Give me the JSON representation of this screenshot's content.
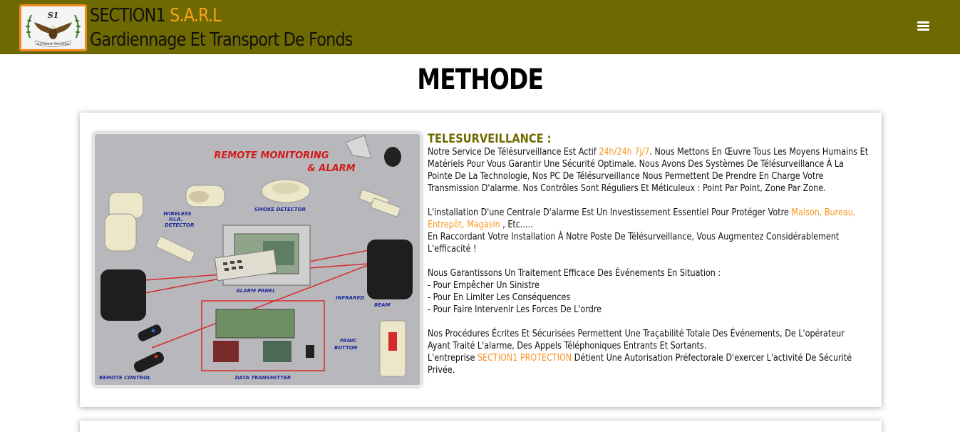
{
  "header": {
    "brand_name": "SECTION1",
    "brand_suffix": "S.A.R.L",
    "tagline": "Gardiennage Et Transport De Fonds",
    "logo_text": "S1",
    "logo_ribbon": "Section1 Sécurité",
    "menu_icon": "hamburger-icon"
  },
  "page": {
    "title": "METHODE"
  },
  "section": {
    "heading": "TELESURVEILLANCE :",
    "image": {
      "title_line1": "REMOTE MONITORING",
      "title_line2": "& ALARM",
      "labels": {
        "wireless": "WIRELESS",
        "pir": "P.I.R.",
        "detector": "DETECTOR",
        "smoke": "SMOKE DETECTOR",
        "alarm_panel": "ALARM PANEL",
        "infrared": "INFRARED",
        "beam": "BEAM",
        "panic": "PANIC",
        "button": "BUTTON",
        "remote_control": "REMOTE CONTROL",
        "data_transmitter": "DATA TRANSMITTER"
      }
    },
    "p1": {
      "a": "Notre Service De Télésurveillance Est Actif ",
      "hl": "24h/24h 7j/7",
      "b": ". Nous Mettons En Œuvre Tous Les Moyens Humains Et Matériels Pour Vous Garantir Une Sécurité Optimale. Nous Avons Des Systèmes De Télésurveillance À La Pointe De La Technologie, Nos PC De Télésurveillance Nous Permettent De Prendre En Charge Votre Transmission D'alarme. Nos Contrôles Sont Réguliers Et Méticuleux : Point Par Point, Zone Par Zone."
    },
    "p2": {
      "a": "L'installation D'une Centrale D'alarme Est Un Investissement Essentiel Pour Protéger Votre ",
      "hl": "Maison, Bureau, Entrepôt, Magasin",
      "b": " , Etc.....",
      "c": "En Raccordant Votre Installation À Notre Poste De Télésurveillance, Vous Augmentez Considérablement L'efficacité !"
    },
    "p3": {
      "intro": "Nous Garantissons Un Traitement Efficace Des Événements En Situation :",
      "items": [
        "- Pour Empêcher Un Sinistre",
        "- Pour En Limiter Les Conséquences",
        "- Pour Faire Intervenir Les Forces De L'ordre"
      ]
    },
    "p4": {
      "a": "Nos Procédures Écrites Et Sécurisées Permettent Une Traçabilité Totale Des Événements, De L'opérateur Ayant Traité L'alarme, Des Appels Téléphoniques Entrants Et Sortants.",
      "b": "L'entreprise ",
      "hl": "SECTION1 PROTECTION",
      "c": " Détient Une Autorisation Préfectorale D'exercer L'activité De Sécurité Privée."
    }
  },
  "colors": {
    "navbar": "#6e6900",
    "accent": "#f7a21c",
    "highlight": "#f7931e",
    "heading": "#6e6900"
  }
}
